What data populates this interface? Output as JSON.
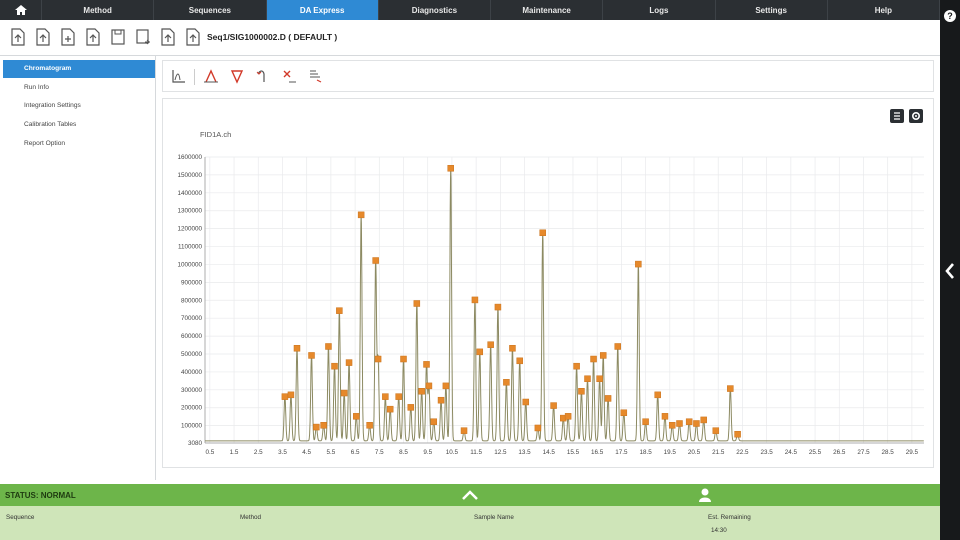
{
  "nav": {
    "home_icon": "home-icon",
    "tabs": [
      {
        "label": "Method",
        "active": false
      },
      {
        "label": "Sequences",
        "active": false
      },
      {
        "label": "DA Express",
        "active": true
      },
      {
        "label": "Diagnostics",
        "active": false
      },
      {
        "label": "Maintenance",
        "active": false
      },
      {
        "label": "Logs",
        "active": false
      },
      {
        "label": "Settings",
        "active": false
      },
      {
        "label": "Help",
        "active": false
      }
    ],
    "help_glyph": "?"
  },
  "toolbar": {
    "sequence_title": "Seq1/SIG1000002.D ( DEFAULT )"
  },
  "sidebar": {
    "items": [
      {
        "label": "Chromatogram",
        "active": true
      },
      {
        "label": "Run Info",
        "active": false
      },
      {
        "label": "Integration Settings",
        "active": false
      },
      {
        "label": "Calibration Tables",
        "active": false
      },
      {
        "label": "Report Option",
        "active": false
      }
    ]
  },
  "chart_panel": {
    "file_label": "FID1A.ch"
  },
  "colors": {
    "nav_bg": "#2b2f33",
    "accent": "#2f8ad4",
    "trace": "#8c8a62",
    "peak_marker": "#e6892b",
    "status_bg": "#6db54a",
    "status_info_bg": "#cfe5b9"
  },
  "chart_data": {
    "type": "line",
    "title": "FID1A.ch",
    "xlim": [
      0.3,
      30.0
    ],
    "ylim": [
      3080,
      1600000
    ],
    "x_ticks": [
      "0.5",
      "1.5",
      "2.5",
      "3.5",
      "4.5",
      "5.5",
      "6.5",
      "7.5",
      "8.5",
      "9.5",
      "10.5",
      "11.5",
      "12.5",
      "13.5",
      "14.5",
      "15.5",
      "16.5",
      "17.5",
      "18.5",
      "19.5",
      "20.5",
      "21.5",
      "22.5",
      "23.5",
      "24.5",
      "25.5",
      "26.5",
      "27.5",
      "28.5",
      "29.5"
    ],
    "y_ticks": [
      "3080",
      "100000",
      "200000",
      "300000",
      "400000",
      "500000",
      "600000",
      "700000",
      "800000",
      "900000",
      "1000000",
      "1100000",
      "1200000",
      "1300000",
      "1400000",
      "1500000",
      "1600000"
    ],
    "grid": true,
    "peaks": [
      [
        3.6,
        250000
      ],
      [
        3.85,
        260000
      ],
      [
        4.1,
        520000
      ],
      [
        4.7,
        480000
      ],
      [
        4.9,
        80000
      ],
      [
        5.2,
        90000
      ],
      [
        5.4,
        530000
      ],
      [
        5.65,
        420000
      ],
      [
        5.85,
        730000
      ],
      [
        6.05,
        270000
      ],
      [
        6.25,
        440000
      ],
      [
        6.75,
        1265000
      ],
      [
        6.55,
        140000
      ],
      [
        7.1,
        90000
      ],
      [
        7.35,
        1010000
      ],
      [
        7.45,
        460000
      ],
      [
        7.75,
        250000
      ],
      [
        7.95,
        180000
      ],
      [
        8.3,
        250000
      ],
      [
        8.5,
        460000
      ],
      [
        8.8,
        190000
      ],
      [
        9.05,
        770000
      ],
      [
        9.25,
        280000
      ],
      [
        9.45,
        430000
      ],
      [
        9.55,
        310000
      ],
      [
        9.75,
        110000
      ],
      [
        10.05,
        230000
      ],
      [
        10.25,
        310000
      ],
      [
        10.45,
        1525000
      ],
      [
        11.0,
        60000
      ],
      [
        11.45,
        790000
      ],
      [
        11.65,
        500000
      ],
      [
        12.1,
        540000
      ],
      [
        12.4,
        750000
      ],
      [
        12.75,
        330000
      ],
      [
        13.0,
        520000
      ],
      [
        13.3,
        450000
      ],
      [
        13.55,
        220000
      ],
      [
        14.05,
        75000
      ],
      [
        14.25,
        1165000
      ],
      [
        14.7,
        200000
      ],
      [
        15.1,
        130000
      ],
      [
        15.3,
        140000
      ],
      [
        15.65,
        420000
      ],
      [
        15.85,
        280000
      ],
      [
        16.1,
        350000
      ],
      [
        16.35,
        460000
      ],
      [
        16.6,
        350000
      ],
      [
        16.75,
        480000
      ],
      [
        16.95,
        240000
      ],
      [
        17.35,
        530000
      ],
      [
        17.6,
        160000
      ],
      [
        18.2,
        990000
      ],
      [
        18.5,
        110000
      ],
      [
        19.0,
        260000
      ],
      [
        19.3,
        140000
      ],
      [
        19.6,
        90000
      ],
      [
        19.9,
        100000
      ],
      [
        20.3,
        110000
      ],
      [
        20.6,
        100000
      ],
      [
        20.9,
        120000
      ],
      [
        21.4,
        60000
      ],
      [
        22.0,
        295000
      ],
      [
        22.3,
        40000
      ]
    ]
  },
  "status": {
    "text": "STATUS: NORMAL",
    "columns": [
      {
        "label": "Sequence",
        "value": ""
      },
      {
        "label": "Method",
        "value": ""
      },
      {
        "label": "Sample Name",
        "value": ""
      },
      {
        "label": "Est. Remaining",
        "value": "14:30"
      }
    ]
  }
}
